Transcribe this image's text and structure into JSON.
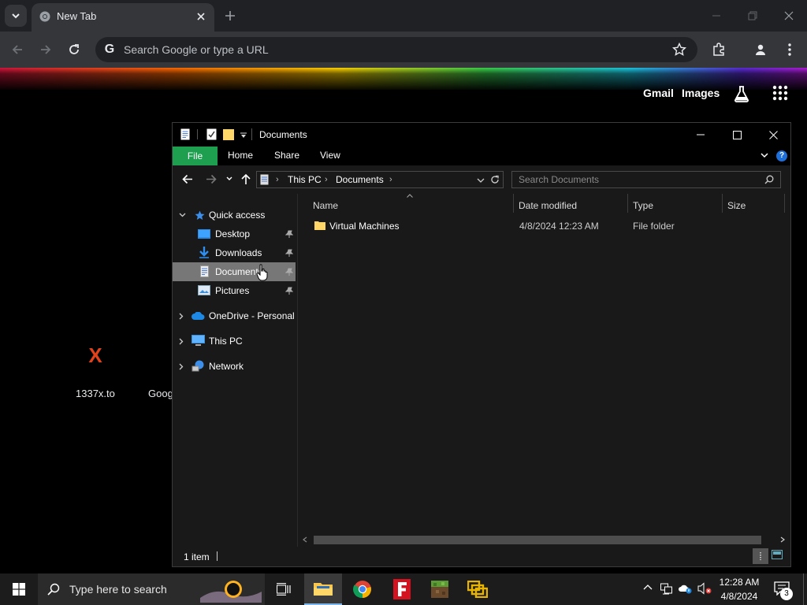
{
  "browser": {
    "tab_title": "New Tab",
    "omnibox_placeholder": "Search Google or type a URL",
    "omnibox_g": "G",
    "links": [
      "Gmail",
      "Images"
    ],
    "shortcuts": [
      {
        "label": "1337x.to",
        "icon_text": "X"
      },
      {
        "label": "Goog"
      }
    ]
  },
  "explorer": {
    "title": "Documents",
    "ribbon_tabs": [
      "File",
      "Home",
      "Share",
      "View"
    ],
    "breadcrumb": [
      "This PC",
      "Documents"
    ],
    "search_placeholder": "Search Documents",
    "nav": {
      "quick_access": "Quick access",
      "items": [
        "Desktop",
        "Downloads",
        "Documents",
        "Pictures"
      ],
      "onedrive": "OneDrive - Personal",
      "this_pc": "This PC",
      "network": "Network"
    },
    "columns": [
      "Name",
      "Date modified",
      "Type",
      "Size"
    ],
    "rows": [
      {
        "name": "Virtual Machines",
        "date": "4/8/2024 12:23 AM",
        "type": "File folder",
        "size": ""
      }
    ],
    "status": "1 item"
  },
  "taskbar": {
    "search_placeholder": "Type here to search",
    "time": "12:28 AM",
    "date": "4/8/2024",
    "notification_count": "3"
  }
}
